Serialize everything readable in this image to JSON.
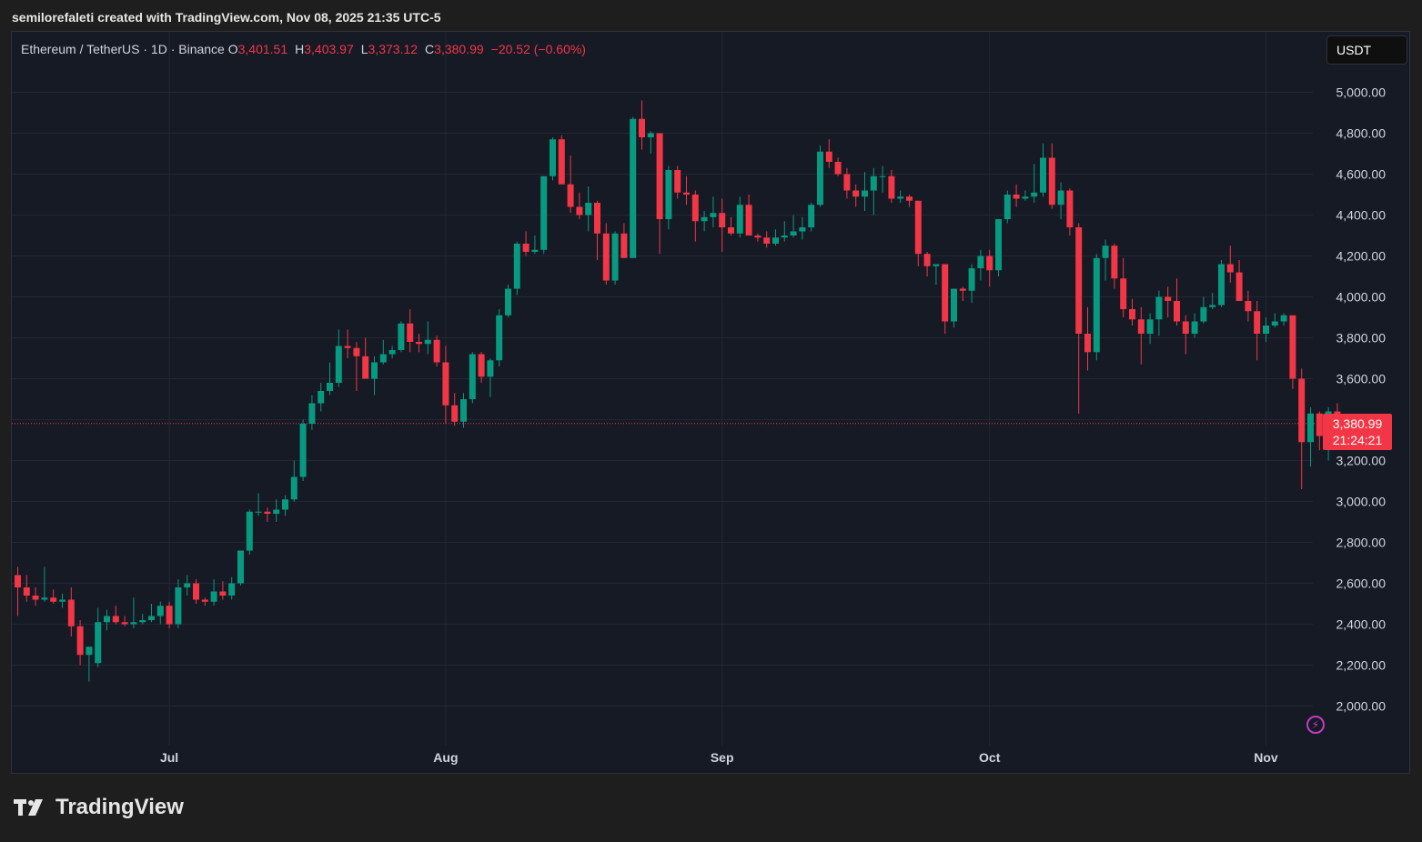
{
  "header": {
    "credit": "semilorefaleti created with TradingView.com, Nov 08, 2025 21:35 UTC-5"
  },
  "legend": {
    "symbol": "Ethereum / TetherUS · 1D · Binance",
    "open_label": "O",
    "open": "3,401.51",
    "high_label": "H",
    "high": "3,403.97",
    "low_label": "L",
    "low": "3,373.12",
    "close_label": "C",
    "close": "3,380.99",
    "change": "−20.52 (−0.60%)"
  },
  "currency": "USDT",
  "last_price": {
    "price": "3,380.99",
    "countdown": "21:24:21"
  },
  "brand": {
    "name": "TradingView",
    "logo_text": "TV"
  },
  "colors": {
    "up": "#089981",
    "down": "#f23645",
    "background": "#161a25",
    "grid": "#242733",
    "text": "#d1d4dc"
  },
  "chart_data": {
    "type": "candlestick",
    "ylim": [
      1900,
      5200
    ],
    "yticks": [
      "5,000.00",
      "4,800.00",
      "4,600.00",
      "4,400.00",
      "4,200.00",
      "4,000.00",
      "3,800.00",
      "3,600.00",
      "3,400.00",
      "3,200.00",
      "3,000.00",
      "2,800.00",
      "2,600.00",
      "2,400.00",
      "2,200.00",
      "2,000.00"
    ],
    "ytick_values": [
      5000,
      4800,
      4600,
      4400,
      4200,
      4000,
      3800,
      3600,
      3400,
      3200,
      3000,
      2800,
      2600,
      2400,
      2200,
      2000
    ],
    "month_ticks": [
      {
        "label": "Jul",
        "day": 17
      },
      {
        "label": "Aug",
        "day": 48
      },
      {
        "label": "Sep",
        "day": 79
      },
      {
        "label": "Oct",
        "day": 109
      },
      {
        "label": "Nov",
        "day": 140
      }
    ],
    "current_price": 3380.99,
    "candles": [
      [
        2640,
        2680,
        2440,
        2580
      ],
      [
        2580,
        2640,
        2510,
        2540
      ],
      [
        2540,
        2580,
        2490,
        2520
      ],
      [
        2520,
        2680,
        2510,
        2530
      ],
      [
        2530,
        2570,
        2500,
        2510
      ],
      [
        2510,
        2550,
        2480,
        2520
      ],
      [
        2520,
        2580,
        2340,
        2390
      ],
      [
        2390,
        2420,
        2200,
        2250
      ],
      [
        2250,
        2290,
        2120,
        2290
      ],
      [
        2210,
        2480,
        2190,
        2410
      ],
      [
        2410,
        2470,
        2370,
        2440
      ],
      [
        2440,
        2490,
        2400,
        2410
      ],
      [
        2410,
        2440,
        2390,
        2400
      ],
      [
        2400,
        2530,
        2380,
        2410
      ],
      [
        2410,
        2450,
        2400,
        2420
      ],
      [
        2420,
        2500,
        2410,
        2440
      ],
      [
        2440,
        2510,
        2400,
        2490
      ],
      [
        2490,
        2510,
        2380,
        2400
      ],
      [
        2400,
        2620,
        2380,
        2580
      ],
      [
        2580,
        2640,
        2540,
        2600
      ],
      [
        2600,
        2620,
        2500,
        2520
      ],
      [
        2520,
        2530,
        2490,
        2510
      ],
      [
        2510,
        2620,
        2490,
        2560
      ],
      [
        2560,
        2610,
        2520,
        2540
      ],
      [
        2540,
        2630,
        2520,
        2600
      ],
      [
        2600,
        2760,
        2590,
        2760
      ],
      [
        2760,
        2960,
        2740,
        2950
      ],
      [
        2950,
        3040,
        2930,
        2950
      ],
      [
        2950,
        2970,
        2900,
        2940
      ],
      [
        2940,
        3010,
        2900,
        2960
      ],
      [
        2960,
        3030,
        2930,
        3010
      ],
      [
        3010,
        3200,
        3000,
        3120
      ],
      [
        3120,
        3400,
        3100,
        3380
      ],
      [
        3380,
        3520,
        3350,
        3480
      ],
      [
        3480,
        3580,
        3440,
        3540
      ],
      [
        3540,
        3680,
        3520,
        3580
      ],
      [
        3580,
        3840,
        3560,
        3760
      ],
      [
        3760,
        3840,
        3700,
        3750
      ],
      [
        3750,
        3780,
        3540,
        3710
      ],
      [
        3710,
        3800,
        3620,
        3600
      ],
      [
        3600,
        3710,
        3520,
        3680
      ],
      [
        3680,
        3790,
        3670,
        3720
      ],
      [
        3720,
        3760,
        3700,
        3740
      ],
      [
        3740,
        3880,
        3730,
        3870
      ],
      [
        3870,
        3940,
        3730,
        3780
      ],
      [
        3780,
        3820,
        3730,
        3770
      ],
      [
        3770,
        3880,
        3720,
        3790
      ],
      [
        3790,
        3810,
        3660,
        3680
      ],
      [
        3680,
        3760,
        3380,
        3470
      ],
      [
        3470,
        3530,
        3370,
        3390
      ],
      [
        3390,
        3530,
        3360,
        3500
      ],
      [
        3500,
        3730,
        3480,
        3720
      ],
      [
        3720,
        3730,
        3580,
        3610
      ],
      [
        3610,
        3700,
        3510,
        3690
      ],
      [
        3690,
        3940,
        3660,
        3910
      ],
      [
        3910,
        4060,
        3900,
        4040
      ],
      [
        4040,
        4270,
        4010,
        4260
      ],
      [
        4260,
        4320,
        4200,
        4220
      ],
      [
        4220,
        4300,
        4210,
        4230
      ],
      [
        4230,
        4360,
        4210,
        4590
      ],
      [
        4590,
        4780,
        4570,
        4770
      ],
      [
        4770,
        4790,
        4600,
        4550
      ],
      [
        4550,
        4690,
        4410,
        4440
      ],
      [
        4440,
        4510,
        4380,
        4400
      ],
      [
        4400,
        4540,
        4320,
        4460
      ],
      [
        4460,
        4470,
        4180,
        4310
      ],
      [
        4310,
        4360,
        4060,
        4080
      ],
      [
        4080,
        4320,
        4060,
        4310
      ],
      [
        4310,
        4360,
        4200,
        4190
      ],
      [
        4190,
        4880,
        4210,
        4870
      ],
      [
        4870,
        4960,
        4720,
        4780
      ],
      [
        4780,
        4810,
        4700,
        4800
      ],
      [
        4800,
        4800,
        4210,
        4380
      ],
      [
        4380,
        4640,
        4330,
        4620
      ],
      [
        4620,
        4640,
        4480,
        4510
      ],
      [
        4510,
        4590,
        4450,
        4500
      ],
      [
        4500,
        4520,
        4270,
        4370
      ],
      [
        4370,
        4420,
        4320,
        4390
      ],
      [
        4390,
        4490,
        4340,
        4410
      ],
      [
        4410,
        4480,
        4220,
        4340
      ],
      [
        4340,
        4390,
        4300,
        4310
      ],
      [
        4310,
        4490,
        4290,
        4450
      ],
      [
        4450,
        4500,
        4300,
        4300
      ],
      [
        4300,
        4310,
        4270,
        4290
      ],
      [
        4290,
        4320,
        4240,
        4260
      ],
      [
        4260,
        4330,
        4250,
        4290
      ],
      [
        4290,
        4370,
        4270,
        4300
      ],
      [
        4300,
        4400,
        4290,
        4320
      ],
      [
        4320,
        4390,
        4280,
        4340
      ],
      [
        4340,
        4460,
        4320,
        4450
      ],
      [
        4450,
        4740,
        4440,
        4710
      ],
      [
        4710,
        4770,
        4630,
        4660
      ],
      [
        4660,
        4680,
        4590,
        4600
      ],
      [
        4600,
        4630,
        4480,
        4520
      ],
      [
        4520,
        4550,
        4440,
        4490
      ],
      [
        4490,
        4610,
        4420,
        4520
      ],
      [
        4520,
        4630,
        4400,
        4590
      ],
      [
        4590,
        4640,
        4510,
        4590
      ],
      [
        4590,
        4620,
        4460,
        4480
      ],
      [
        4480,
        4520,
        4460,
        4490
      ],
      [
        4490,
        4500,
        4440,
        4470
      ],
      [
        4470,
        4470,
        4150,
        4210
      ],
      [
        4210,
        4220,
        4100,
        4150
      ],
      [
        4150,
        4160,
        4060,
        4160
      ],
      [
        4160,
        4160,
        3820,
        3880
      ],
      [
        3880,
        4040,
        3850,
        4040
      ],
      [
        4040,
        4050,
        3980,
        4030
      ],
      [
        4030,
        4160,
        3970,
        4140
      ],
      [
        4140,
        4230,
        4080,
        4200
      ],
      [
        4200,
        4230,
        4050,
        4130
      ],
      [
        4130,
        4380,
        4100,
        4380
      ],
      [
        4380,
        4520,
        4360,
        4500
      ],
      [
        4500,
        4550,
        4440,
        4480
      ],
      [
        4480,
        4520,
        4470,
        4490
      ],
      [
        4490,
        4650,
        4460,
        4510
      ],
      [
        4510,
        4750,
        4490,
        4680
      ],
      [
        4680,
        4750,
        4430,
        4450
      ],
      [
        4450,
        4560,
        4380,
        4520
      ],
      [
        4520,
        4530,
        4300,
        4340
      ],
      [
        4340,
        4360,
        3430,
        3820
      ],
      [
        3820,
        3950,
        3640,
        3730
      ],
      [
        3730,
        4210,
        3690,
        4190
      ],
      [
        4190,
        4280,
        4080,
        4250
      ],
      [
        4250,
        4260,
        4040,
        4090
      ],
      [
        4090,
        4190,
        3900,
        3940
      ],
      [
        3940,
        3990,
        3860,
        3890
      ],
      [
        3890,
        3950,
        3670,
        3820
      ],
      [
        3820,
        3920,
        3770,
        3890
      ],
      [
        3890,
        4030,
        3810,
        4000
      ],
      [
        4000,
        4050,
        3900,
        3980
      ],
      [
        3980,
        4090,
        3860,
        3880
      ],
      [
        3880,
        3910,
        3720,
        3820
      ],
      [
        3820,
        3920,
        3800,
        3880
      ],
      [
        3880,
        4000,
        3870,
        3950
      ],
      [
        3950,
        4020,
        3940,
        3960
      ],
      [
        3960,
        4180,
        3950,
        4160
      ],
      [
        4160,
        4250,
        4070,
        4120
      ],
      [
        4120,
        4180,
        3990,
        3980
      ],
      [
        3980,
        4030,
        3880,
        3930
      ],
      [
        3930,
        3980,
        3690,
        3820
      ],
      [
        3820,
        3900,
        3780,
        3860
      ],
      [
        3860,
        3920,
        3850,
        3880
      ],
      [
        3880,
        3920,
        3860,
        3910
      ],
      [
        3910,
        3910,
        3550,
        3600
      ],
      [
        3600,
        3650,
        3060,
        3290
      ],
      [
        3290,
        3460,
        3170,
        3430
      ],
      [
        3430,
        3440,
        3250,
        3320
      ],
      [
        3320,
        3460,
        3200,
        3440
      ],
      [
        3440,
        3480,
        3370,
        3401.51
      ],
      [
        3401.51,
        3403.97,
        3373.12,
        3380.99
      ]
    ]
  }
}
